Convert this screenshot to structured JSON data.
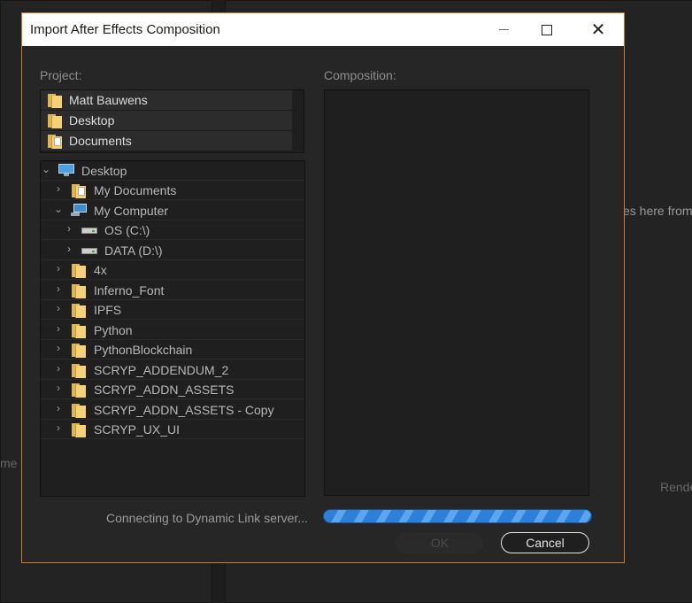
{
  "background": {
    "side_text": "es here from",
    "side_text_2": "me l",
    "render_label": "Rende"
  },
  "dialog": {
    "title": "Import After Effects Composition",
    "project_label": "Project:",
    "composition_label": "Composition:",
    "recent_items": [
      {
        "label": "Matt Bauwens",
        "icon": "folder-icon"
      },
      {
        "label": "Desktop",
        "icon": "folder-icon"
      },
      {
        "label": "Documents",
        "icon": "documents-folder-icon"
      }
    ],
    "tree": [
      {
        "label": "Desktop",
        "icon": "desktop-icon",
        "expanded": true,
        "level": 0
      },
      {
        "label": "My Documents",
        "icon": "documents-folder-icon",
        "expanded": false,
        "level": 1
      },
      {
        "label": "My Computer",
        "icon": "computer-icon",
        "expanded": true,
        "level": 1
      },
      {
        "label": "OS (C:\\)",
        "icon": "drive-icon",
        "expanded": false,
        "level": 2
      },
      {
        "label": "DATA (D:\\)",
        "icon": "drive-icon",
        "expanded": false,
        "level": 2
      },
      {
        "label": "4x",
        "icon": "folder-icon",
        "expanded": false,
        "level": 1
      },
      {
        "label": "Inferno_Font",
        "icon": "folder-icon",
        "expanded": false,
        "level": 1
      },
      {
        "label": "IPFS",
        "icon": "folder-icon",
        "expanded": false,
        "level": 1
      },
      {
        "label": "Python",
        "icon": "folder-icon",
        "expanded": false,
        "level": 1
      },
      {
        "label": "PythonBlockchain",
        "icon": "folder-icon",
        "expanded": false,
        "level": 1
      },
      {
        "label": "SCRYP_ADDENDUM_2",
        "icon": "folder-icon",
        "expanded": false,
        "level": 1
      },
      {
        "label": "SCRYP_ADDN_ASSETS",
        "icon": "folder-icon",
        "expanded": false,
        "level": 1
      },
      {
        "label": "SCRYP_ADDN_ASSETS - Copy",
        "icon": "folder-icon",
        "expanded": false,
        "level": 1
      },
      {
        "label": "SCRYP_UX_UI",
        "icon": "folder-icon",
        "expanded": false,
        "level": 1
      }
    ],
    "status": "Connecting to Dynamic Link server...",
    "progress_state": "indeterminate",
    "ok_label": "OK",
    "cancel_label": "Cancel",
    "colors": {
      "accent_border": "#c87a32",
      "progress": "#2d7fd8",
      "folder": "#f5d27a"
    }
  }
}
